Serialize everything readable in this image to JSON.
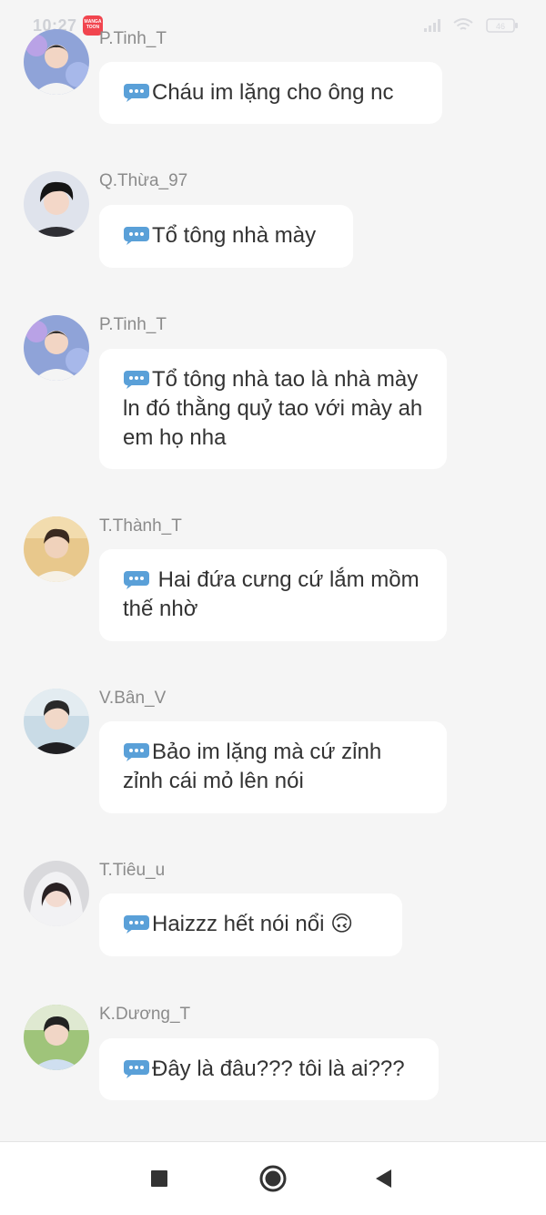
{
  "status_bar": {
    "time": "10:27",
    "app_badge_text": "MANGA TOON",
    "badge_color": "#f1454f",
    "icons": [
      "signal-icon",
      "wifi-icon",
      "battery-icon"
    ],
    "battery": "46"
  },
  "messages": [
    {
      "name": "P.Tinh_T",
      "text": "Cháu im lặng cho ông nc",
      "avatar": "boy-white-shirt"
    },
    {
      "name": "Q.Thừa_97",
      "text": "Tổ tông nhà mày",
      "avatar": "boy-dark-hair"
    },
    {
      "name": "P.Tinh_T",
      "text": "Tổ tông nhà tao là nhà mày ln đó thằng quỷ tao với mày ah em họ nha",
      "avatar": "boy-white-shirt"
    },
    {
      "name": "T.Thành_T",
      "text": " Hai đứa cưng cứ lắm mồm thế nhờ",
      "avatar": "boy-sunny"
    },
    {
      "name": "V.Bân_V",
      "text": "Bảo im lặng mà cứ zỉnh zỉnh cái mỏ lên nói",
      "avatar": "boy-black-jacket"
    },
    {
      "name": "T.Tiêu_u",
      "text": "Haizzz hết nói nổi 🙃",
      "avatar": "girl-hood"
    },
    {
      "name": "K.Dương_T",
      "text": "Đây là đâu??? tôi là ai???",
      "avatar": "boy-outdoor"
    }
  ],
  "nav_bar": {
    "recent_icon": "square-icon",
    "home_icon": "circle-icon",
    "back_icon": "triangle-back-icon"
  },
  "colors": {
    "background": "#f5f5f5",
    "bubble": "#ffffff",
    "name_text": "#8b8b8b",
    "message_text": "#333333",
    "dots_icon": "#5aa0d8"
  }
}
